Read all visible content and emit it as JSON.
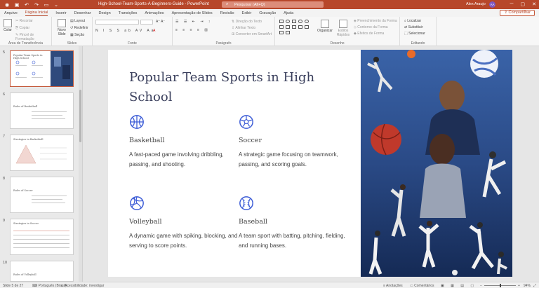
{
  "window": {
    "title": "High-School-Team-Sports-A-Beginners-Guide  -  PowerPoint",
    "search_placeholder": "Pesquisar (Alt+Q)",
    "user_name": "Alex Araujo",
    "user_initials": "AA"
  },
  "menu": {
    "tabs": [
      "Arquivo",
      "Página Inicial",
      "Inserir",
      "Desenhar",
      "Design",
      "Transições",
      "Animações",
      "Apresentação de Slides",
      "Revisão",
      "Exibir",
      "Gravação",
      "Ajuda"
    ],
    "active_tab": "Página Inicial",
    "share_label": "Compartilhar"
  },
  "ribbon": {
    "clipboard": {
      "paste": "Colar",
      "cut": "Recortar",
      "copy": "Copiar",
      "format_painter": "Pincel de Formatação",
      "label": "Área de Transferência"
    },
    "slides": {
      "new_slide": "Novo Slide",
      "layout": "Layout",
      "reset": "Redefinir",
      "section": "Seção",
      "label": "Slides"
    },
    "font": {
      "label": "Fonte"
    },
    "paragraph": {
      "text_direction": "Direção do Texto",
      "align_text": "Alinhar Texto",
      "convert_smartart": "Converter em SmartArt",
      "label": "Parágrafo"
    },
    "drawing": {
      "arrange": "Organizar",
      "quick_styles": "Estilos Rápidos",
      "shape_fill": "Preenchimento da Forma",
      "shape_outline": "Contorno da Forma",
      "shape_effects": "Efeitos de Forma",
      "label": "Desenho"
    },
    "editing": {
      "find": "Localizar",
      "replace": "Substituir",
      "select": "Selecionar",
      "label": "Editando"
    }
  },
  "thumbnails": {
    "numbers": [
      "5",
      "6",
      "7",
      "8",
      "9",
      "10"
    ],
    "titles": [
      "Popular Team Sports in High School",
      "Rules of Basketball",
      "Strategies in Basketball",
      "Rules of Soccer",
      "Strategies in Soccer",
      "Rules of Volleyball"
    ],
    "active_index": 0
  },
  "slide": {
    "title": "Popular Team Sports in High School",
    "sports": [
      {
        "name": "Basketball",
        "description": "A fast-paced game involving dribbling, passing, and shooting.",
        "icon": "basketball-icon"
      },
      {
        "name": "Soccer",
        "description": "A strategic game focusing on teamwork, passing, and scoring goals.",
        "icon": "soccer-ball-icon"
      },
      {
        "name": "Volleyball",
        "description": "A dynamic game with spiking, blocking, and serving to score points.",
        "icon": "volleyball-icon"
      },
      {
        "name": "Baseball",
        "description": "A team sport with batting, pitching, fielding, and running bases.",
        "icon": "baseball-icon"
      }
    ],
    "accent_color": "#3b5bd6"
  },
  "status": {
    "slide_counter": "Slide 5 de 27",
    "language": "Português (Brasil)",
    "accessibility": "Acessibilidade: investigar",
    "notes": "Anotações",
    "comments": "Comentários",
    "zoom": "94%"
  },
  "colors": {
    "brand": "#b7472a",
    "title_text": "#3a3f5c"
  }
}
